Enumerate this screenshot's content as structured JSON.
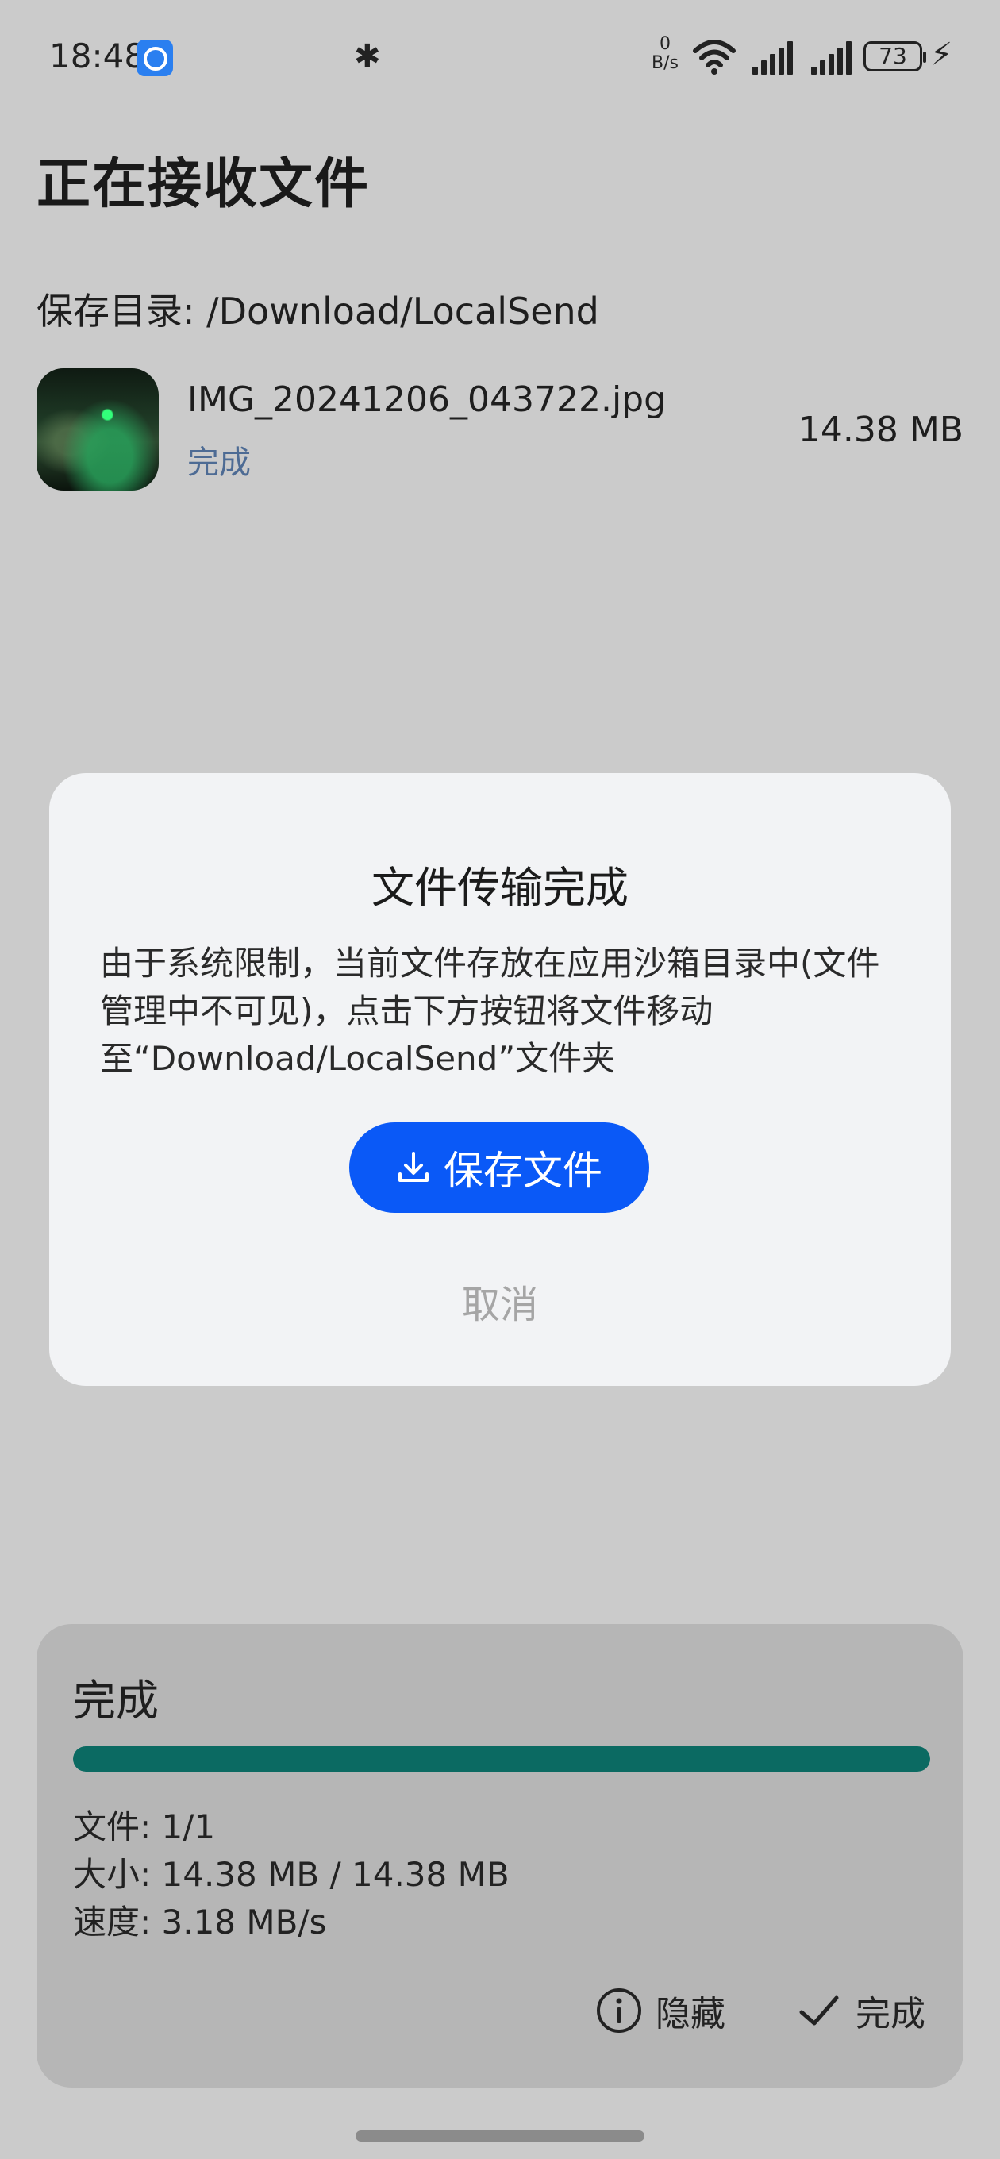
{
  "status_bar": {
    "time": "18:48",
    "net_speed_value": "0",
    "net_speed_unit": "B/s",
    "battery": "73",
    "icons": [
      "app-notification-icon",
      "bluetooth-icon",
      "wifi-icon",
      "signal-icon",
      "signal-icon",
      "battery-icon",
      "charging-icon"
    ]
  },
  "page": {
    "title": "正在接收文件",
    "save_dir_label": "保存目录: ",
    "save_dir_value": "/Download/LocalSend"
  },
  "file": {
    "name": "IMG_20241206_043722.jpg",
    "status": "完成",
    "size": "14.38 MB"
  },
  "dialog": {
    "title": "文件传输完成",
    "body": "由于系统限制，当前文件存放在应用沙箱目录中(文件管理中不可见)，点击下方按钮将文件移动至“Download/LocalSend”文件夹",
    "save_button": "保存文件",
    "cancel_button": "取消",
    "accent_color": "#0a59f7"
  },
  "progress": {
    "title": "完成",
    "fraction": 1.0,
    "files_label": "文件: ",
    "files_value": "1/1",
    "size_label": "大小: ",
    "size_value": "14.38 MB / 14.38 MB",
    "speed_label": "速度: ",
    "speed_value": "3.18 MB/s",
    "hide_button": "隐藏",
    "done_button": "完成",
    "bar_color": "#0b6a62"
  }
}
